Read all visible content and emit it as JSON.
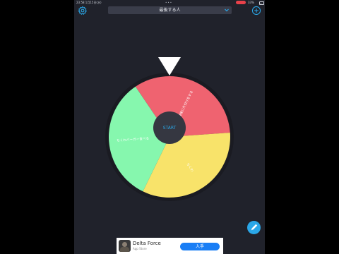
{
  "status": {
    "time": "23:58  1月15日(水)",
    "battery": "33%"
  },
  "toolbar": {
    "title": "最後する人",
    "gear_icon": "gear-icon",
    "add_icon": "plus-circle-icon",
    "dropdown_icon": "chevron-down-icon"
  },
  "wheel": {
    "center_label": "START",
    "segments": [
      {
        "label": "最後に片付けをする",
        "color": "#ef6370",
        "share": 0.3333
      },
      {
        "label": "ちくわ",
        "color": "#f8e36a",
        "share": 0.3333
      },
      {
        "label": "ちくわバーガー食べる",
        "color": "#86f7ae",
        "share": 0.3333
      }
    ],
    "colors": {
      "rim": "#1a1b22",
      "hub": "#353741",
      "pointer": "#ffffff",
      "center_text": "#2aa7e8"
    }
  },
  "fab": {
    "icon": "pencil-icon",
    "color": "#2aa7e8"
  },
  "ad": {
    "app_name": "Delta Force",
    "store": "App Store",
    "cta": "入手"
  }
}
